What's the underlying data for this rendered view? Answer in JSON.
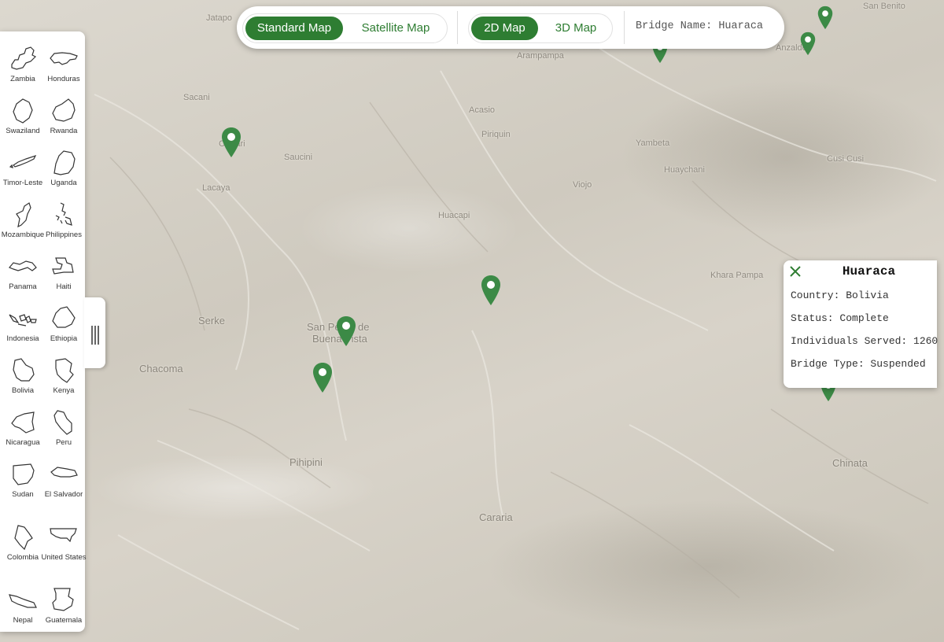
{
  "map_type_toggle": {
    "standard_label": "Standard Map",
    "satellite_label": "Satellite Map",
    "selected": "Standard Map"
  },
  "view_toggle": {
    "view_2d_label": "2D Map",
    "view_3d_label": "3D Map",
    "selected": "2D Map"
  },
  "bridge_name_display": "Bridge Name: Huaraca",
  "countries": [
    {
      "name": "Zambia"
    },
    {
      "name": "Honduras"
    },
    {
      "name": "Swaziland"
    },
    {
      "name": "Rwanda"
    },
    {
      "name": "Timor-Leste"
    },
    {
      "name": "Uganda"
    },
    {
      "name": "Mozambique"
    },
    {
      "name": "Philippines"
    },
    {
      "name": "Panama"
    },
    {
      "name": "Haiti"
    },
    {
      "name": "Indonesia"
    },
    {
      "name": "Ethiopia"
    },
    {
      "name": "Bolivia"
    },
    {
      "name": "Kenya"
    },
    {
      "name": "Nicaragua"
    },
    {
      "name": "Peru"
    },
    {
      "name": "Sudan"
    },
    {
      "name": "El Salvador"
    },
    {
      "name": "Colombia"
    },
    {
      "name": "United States"
    },
    {
      "name": "Nepal"
    },
    {
      "name": "Guatemala"
    }
  ],
  "place_labels": [
    "Chillari",
    "Sacani",
    "Saucini",
    "Lacaya",
    "Serke",
    "Chacoma",
    "San Pedro de",
    "Buena Vista",
    "Pihipini",
    "Cararia",
    "Acasio",
    "Piriquin",
    "Viojo",
    "Yambeta",
    "Huaychani",
    "Huacapi",
    "Khara Pampa",
    "Cusi Cusi",
    "Chinata",
    "Arampampa",
    "Anzaldo",
    "San Benito",
    "Jatapo"
  ],
  "popup": {
    "title": "Huaraca",
    "country": "Country: Bolivia",
    "status": "Status: Complete",
    "individuals": "Individuals Served: 1260",
    "bridge_type": "Bridge Type: Suspended"
  },
  "colors": {
    "accent": "#2e7d32",
    "marker": "#3c8a46"
  }
}
